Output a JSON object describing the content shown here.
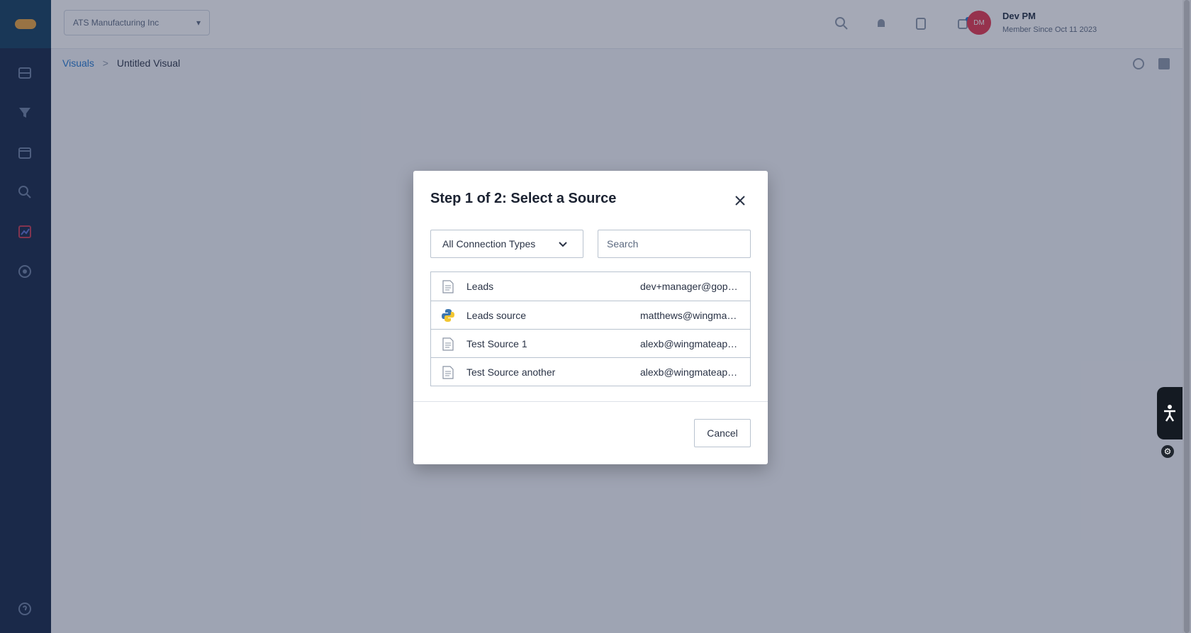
{
  "app": {
    "org_selector": "ATS Manufacturing Inc",
    "user_initials": "DM",
    "user_name": "Dev PM",
    "user_subtitle": "Member Since Oct 11 2023"
  },
  "breadcrumb": {
    "parent": "Visuals",
    "separator": ">",
    "current": "Untitled Visual"
  },
  "modal": {
    "title": "Step 1 of 2: Select a Source",
    "connection_type": "All Connection Types",
    "search_placeholder": "Search",
    "sources": [
      {
        "name": "Leads",
        "owner": "dev+manager@gophr.com",
        "icon": "document-icon"
      },
      {
        "name": "Leads source",
        "owner": "matthews@wingmateapp.com",
        "icon": "python-icon"
      },
      {
        "name": "Test Source 1",
        "owner": "alexb@wingmateapp.com",
        "icon": "document-icon"
      },
      {
        "name": "Test Source another",
        "owner": "alexb@wingmateapp.com",
        "icon": "document-icon"
      }
    ],
    "cancel_label": "Cancel"
  },
  "colors": {
    "sidebar_bg": "#102444",
    "overlay": "rgba(40,50,80,0.42)",
    "link": "#1f77d0",
    "avatar": "#e5334b"
  }
}
